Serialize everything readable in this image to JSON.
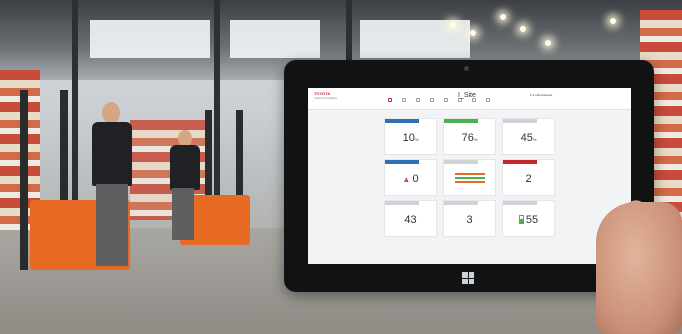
{
  "app": {
    "brand": "TOYOTA",
    "brand_sub": "material handling",
    "title": "I_Site",
    "user": "▾  ● Administrator"
  },
  "nav": [
    {
      "label": "Home",
      "active": true
    },
    {
      "label": "Dashboard",
      "active": false
    },
    {
      "label": "Drivers",
      "active": false
    },
    {
      "label": "Trucks",
      "active": false
    },
    {
      "label": "Reports",
      "active": false
    },
    {
      "label": "Settings",
      "active": false
    },
    {
      "label": "Admin",
      "active": false
    },
    {
      "label": "Help",
      "active": false
    }
  ],
  "cards": [
    {
      "value": "10",
      "unit": "%",
      "color": "#2f6fb3"
    },
    {
      "value": "76",
      "unit": "%",
      "color": "#4bb14f"
    },
    {
      "value": "45",
      "unit": "%",
      "color": "#cfd2d6"
    },
    {
      "value": "0",
      "unit": "",
      "color": "#2f6fb3",
      "icon": "warning-triangle-icon"
    },
    {
      "value": "",
      "unit": "",
      "color": "#cfd2d6",
      "icon": "mini-chart-icon"
    },
    {
      "value": "2",
      "unit": "",
      "color": "#c1272d"
    },
    {
      "value": "43",
      "unit": "",
      "color": "#cfd2d6"
    },
    {
      "value": "3",
      "unit": "",
      "color": "#cfd2d6"
    },
    {
      "value": "55",
      "unit": "",
      "color": "#cfd2d6",
      "icon": "battery-icon"
    }
  ],
  "colors": {
    "accent": "#c1272d",
    "truck": "#e76a24"
  }
}
